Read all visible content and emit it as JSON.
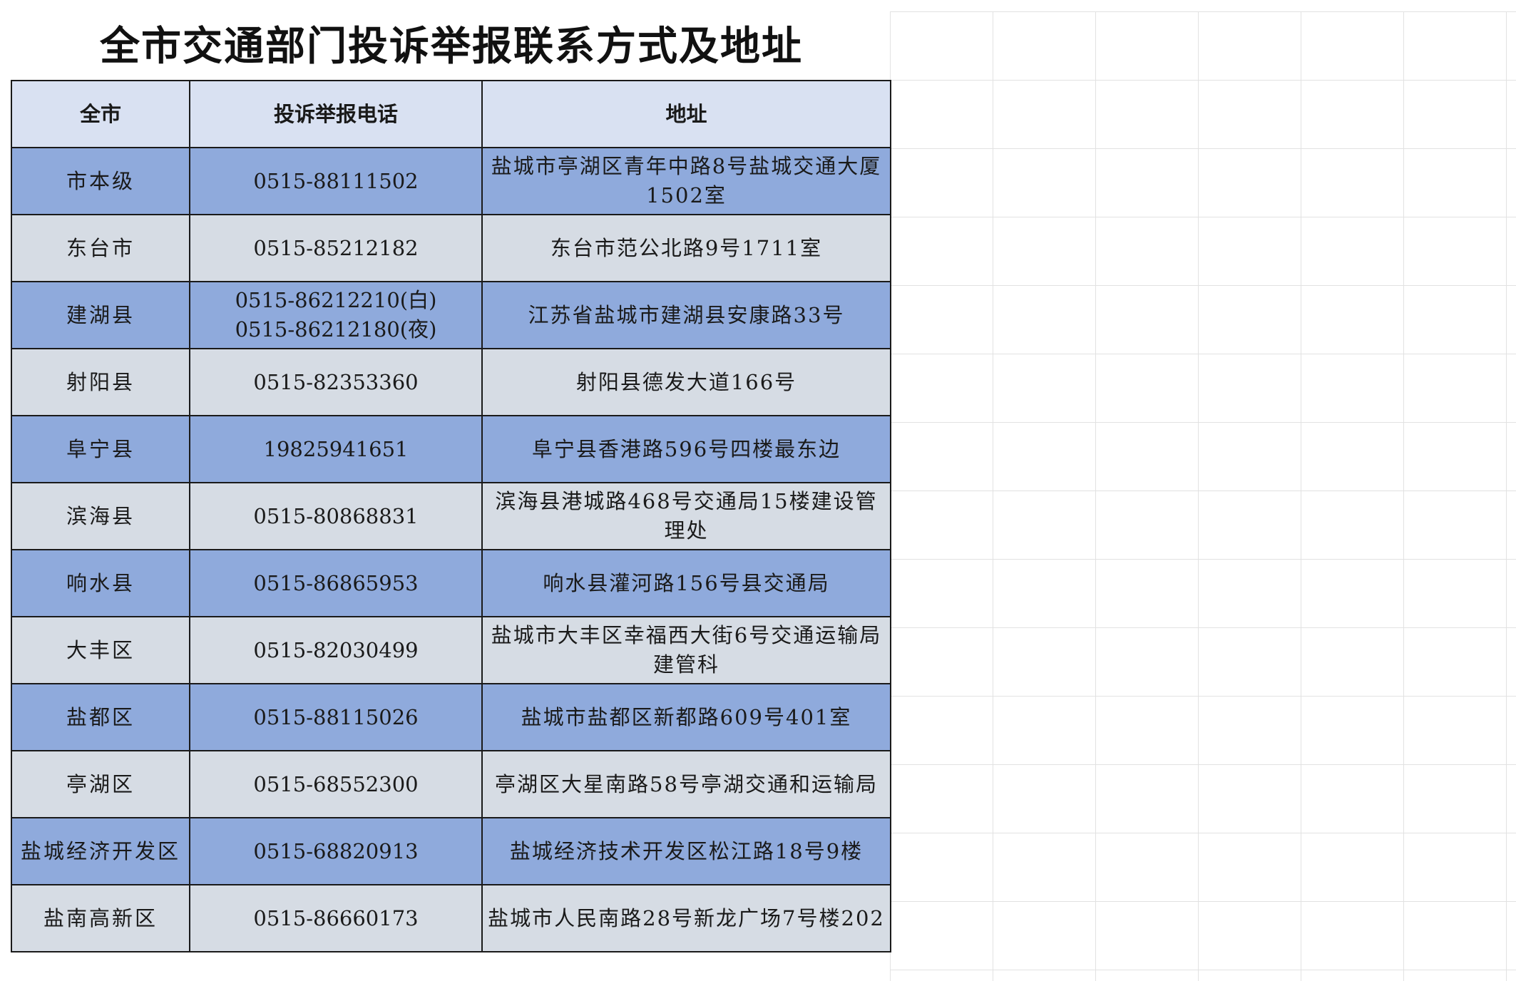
{
  "title": "全市交通部门投诉举报联系方式及地址",
  "table": {
    "headers": [
      "全市",
      "投诉举报电话",
      "地址"
    ],
    "rows": [
      {
        "area": "市本级",
        "phone": "0515-88111502",
        "address": "盐城市亭湖区青年中路8号盐城交通大厦1502室"
      },
      {
        "area": "东台市",
        "phone": "0515-85212182",
        "address": "东台市范公北路9号1711室"
      },
      {
        "area": "建湖县",
        "phone": "0515-86212210(白)\n0515-86212180(夜)",
        "address": "江苏省盐城市建湖县安康路33号"
      },
      {
        "area": "射阳县",
        "phone": "0515-82353360",
        "address": "射阳县德发大道166号"
      },
      {
        "area": "阜宁县",
        "phone": "19825941651",
        "address": "阜宁县香港路596号四楼最东边"
      },
      {
        "area": "滨海县",
        "phone": "0515-80868831",
        "address": "滨海县港城路468号交通局15楼建设管理处"
      },
      {
        "area": "响水县",
        "phone": "0515-86865953",
        "address": "响水县灌河路156号县交通局"
      },
      {
        "area": "大丰区",
        "phone": "0515-82030499",
        "address": "盐城市大丰区幸福西大街6号交通运输局建管科"
      },
      {
        "area": "盐都区",
        "phone": "0515-88115026",
        "address": "盐城市盐都区新都路609号401室"
      },
      {
        "area": "亭湖区",
        "phone": "0515-68552300",
        "address": "亭湖区大星南路58号亭湖交通和运输局"
      },
      {
        "area": "盐城经济开发区",
        "phone": "0515-68820913",
        "address": "盐城经济技术开发区松江路18号9楼"
      },
      {
        "area": "盐南高新区",
        "phone": "0515-86660173",
        "address": "盐城市人民南路28号新龙广场7号楼202"
      }
    ]
  },
  "colors": {
    "header_bg": "#d9e1f2",
    "row_a_bg": "#8faadc",
    "row_b_bg": "#d6dce4",
    "border": "#1a1a1a",
    "grid": "#e2e2e2"
  }
}
